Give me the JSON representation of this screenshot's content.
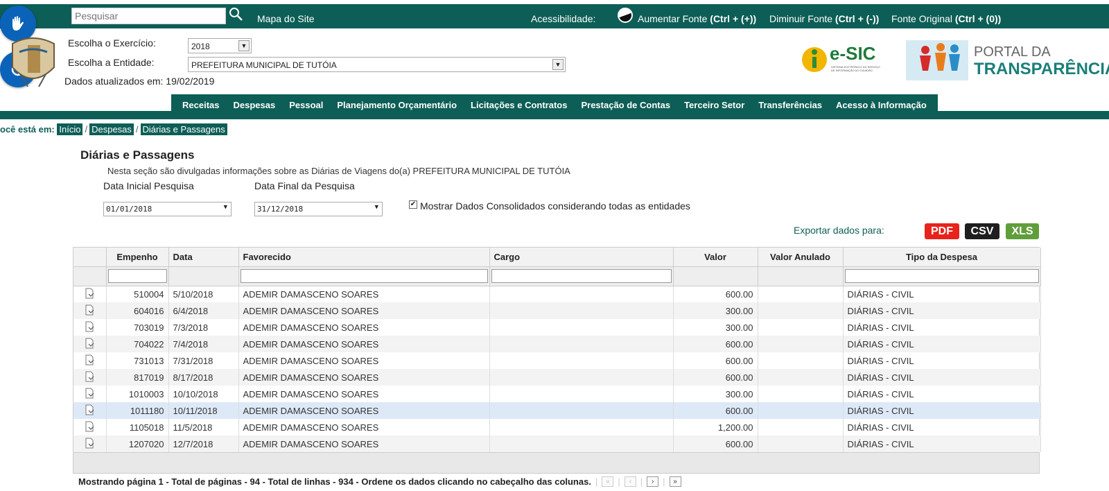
{
  "topbar": {
    "search_placeholder": "Pesquisar",
    "sitemap": "Mapa do Site",
    "accessibility": "Acessibilidade:",
    "increase_font": "Aumentar Fonte",
    "increase_font_key": "(Ctrl + (+))",
    "decrease_font": "Diminuir Fonte",
    "decrease_font_key": "(Ctrl + (-))",
    "original_font": "Fonte Original",
    "original_font_key": "(Ctrl + (0))"
  },
  "header": {
    "exercise_label": "Escolha o Exercício:",
    "exercise_value": "2018",
    "entity_label": "Escolha a Entidade:",
    "entity_value": "PREFEITURA MUNICIPAL DE TUTÓIA",
    "updated": "Dados atualizados em: 19/02/2019",
    "esic_title": "e-SIC",
    "esic_sub": "SISTEMA ELETRÔNICO DO SERVIÇO DE INFORMAÇÃO AO CIDADÃO",
    "portal_line1": "PORTAL DA",
    "portal_line2": "TRANSPARÊNCIA"
  },
  "nav": [
    "Receitas",
    "Despesas",
    "Pessoal",
    "Planejamento Orçamentário",
    "Licitações e Contratos",
    "Prestação de Contas",
    "Terceiro Setor",
    "Transferências",
    "Acesso à Informação"
  ],
  "breadcrumb": {
    "prefix": "ocê está em:",
    "items": [
      "Início",
      "Despesas",
      "Diárias e Passagens"
    ]
  },
  "page": {
    "title": "Diárias e Passagens",
    "description": "Nesta seção são divulgadas informações sobre as Diárias de Viagens do(a) PREFEITURA MUNICIPAL DE TUTÓIA"
  },
  "filters": {
    "start_label": "Data Inicial Pesquisa",
    "start_value": "01/01/2018",
    "end_label": "Data Final da Pesquisa",
    "end_value": "31/12/2018",
    "consolidated_label": "Mostrar Dados Consolidados considerando todas as entidades",
    "consolidated_checked": true
  },
  "export": {
    "label": "Exportar dados para:",
    "pdf": "PDF",
    "csv": "CSV",
    "xls": "XLS",
    "pdf_color": "#e8231c",
    "csv_color": "#1f1f1f",
    "xls_color": "#5f9e3a"
  },
  "grid": {
    "columns": [
      "Empenho",
      "Data",
      "Favorecido",
      "Cargo",
      "Valor",
      "Valor Anulado",
      "Tipo da Despesa"
    ],
    "rows": [
      [
        "510004",
        "5/10/2018",
        "ADEMIR DAMASCENO SOARES",
        "",
        "600.00",
        "",
        "DIÁRIAS - CIVIL"
      ],
      [
        "604016",
        "6/4/2018",
        "ADEMIR DAMASCENO SOARES",
        "",
        "300.00",
        "",
        "DIÁRIAS - CIVIL"
      ],
      [
        "703019",
        "7/3/2018",
        "ADEMIR DAMASCENO SOARES",
        "",
        "300.00",
        "",
        "DIÁRIAS - CIVIL"
      ],
      [
        "704022",
        "7/4/2018",
        "ADEMIR DAMASCENO SOARES",
        "",
        "600.00",
        "",
        "DIÁRIAS - CIVIL"
      ],
      [
        "731013",
        "7/31/2018",
        "ADEMIR DAMASCENO SOARES",
        "",
        "600.00",
        "",
        "DIÁRIAS - CIVIL"
      ],
      [
        "817019",
        "8/17/2018",
        "ADEMIR DAMASCENO SOARES",
        "",
        "600.00",
        "",
        "DIÁRIAS - CIVIL"
      ],
      [
        "1010003",
        "10/10/2018",
        "ADEMIR DAMASCENO SOARES",
        "",
        "300.00",
        "",
        "DIÁRIAS - CIVIL"
      ],
      [
        "1011180",
        "10/11/2018",
        "ADEMIR DAMASCENO SOARES",
        "",
        "600.00",
        "",
        "DIÁRIAS - CIVIL"
      ],
      [
        "1105018",
        "11/5/2018",
        "ADEMIR DAMASCENO SOARES",
        "",
        "1,200.00",
        "",
        "DIÁRIAS - CIVIL"
      ],
      [
        "1207020",
        "12/7/2018",
        "ADEMIR DAMASCENO SOARES",
        "",
        "600.00",
        "",
        "DIÁRIAS - CIVIL"
      ]
    ],
    "selected_row": 7
  },
  "pager": {
    "text": "Mostrando página 1 - Total de páginas - 94 - Total de linhas - 934 - Ordene os dados clicando no cabeçalho das colunas."
  }
}
